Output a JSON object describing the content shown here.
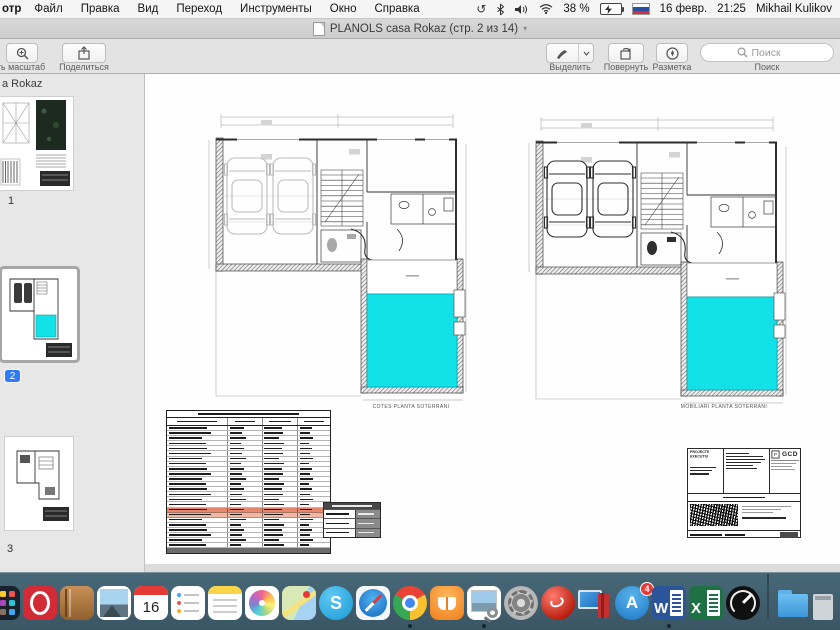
{
  "menubar": {
    "app_partial": "отр",
    "items": [
      "Файл",
      "Правка",
      "Вид",
      "Переход",
      "Инструменты",
      "Окно",
      "Справка"
    ],
    "status": {
      "battery_percent": "38 %",
      "date": "16 февр.",
      "time": "21:25",
      "user": "Mikhail Kulikov"
    }
  },
  "titlebar": {
    "title": "PLANOLS casa Rokaz (стр. 2 из 14)"
  },
  "toolbar": {
    "zoom_label": "ть масштаб",
    "share_label": "Поделиться",
    "select_label": "Выделить",
    "rotate_label": "Повернуть",
    "markup_label": "Разметка",
    "search_label": "Поиск",
    "search_placeholder": "Поиск"
  },
  "sidebar": {
    "header": "a Rokaz",
    "pages": [
      {
        "number": "1",
        "selected": false
      },
      {
        "number": "2",
        "selected": true
      },
      {
        "number": "3",
        "selected": false
      }
    ]
  },
  "document": {
    "captions": {
      "left": "COTES PLANTA SOTERRANI",
      "right": "MOBILIARI PLANTA SOTERRANI"
    },
    "area_table": {
      "data_rows": 24,
      "columns": 4,
      "highlight_rows": [
        16,
        17
      ]
    },
    "summary_table": {
      "rows": 3
    },
    "titleblock": {
      "project": "PROJECTE EXECUTIU",
      "logo": "GCD",
      "sheet_letter": "P"
    }
  },
  "dock": {
    "calendar_day": "16",
    "app_store_badge": "4"
  },
  "colors": {
    "pool": "#12e2e8",
    "highlight_row_1": "#e8876c",
    "highlight_row_2": "#f2b7a2",
    "selected_page_badge": "#2e7cf6",
    "dock_bg": "#476878"
  }
}
